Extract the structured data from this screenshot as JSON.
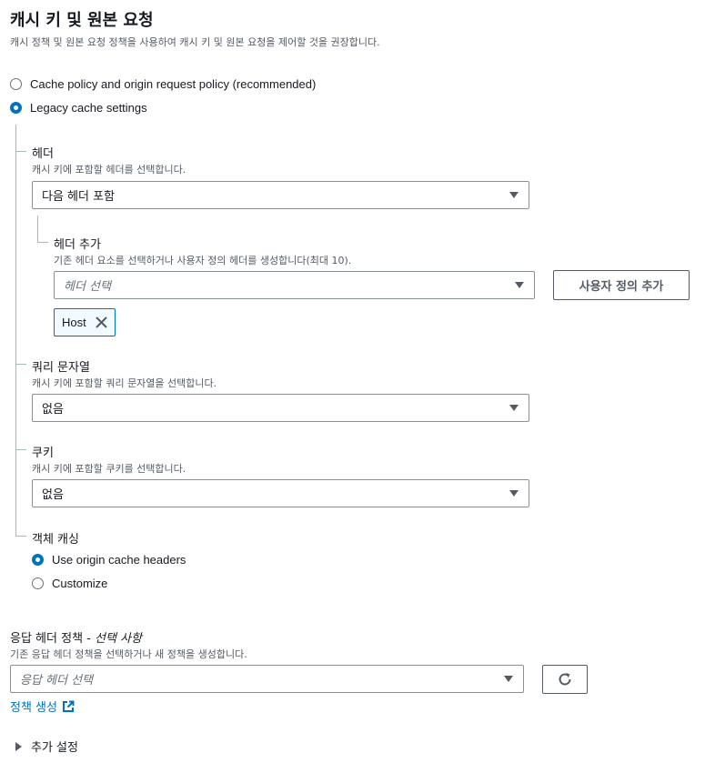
{
  "header": {
    "title": "캐시 키 및 원본 요청",
    "description": "캐시 정책 및 원본 요청 정책을 사용하여 캐시 키 및 원본 요청을 제어할 것을 권장합니다."
  },
  "mode_options": [
    {
      "label": "Cache policy and origin request policy (recommended)",
      "checked": false
    },
    {
      "label": "Legacy cache settings",
      "checked": true
    }
  ],
  "headers": {
    "label": "헤더",
    "description": "캐시 키에 포함할 헤더를 선택합니다.",
    "selected": "다음 헤더 포함",
    "add": {
      "label": "헤더 추가",
      "description": "기존 헤더 요소를 선택하거나 사용자 정의 헤더를 생성합니다(최대 10).",
      "placeholder": "헤더 선택",
      "custom_button": "사용자 정의 추가",
      "tokens": [
        "Host"
      ]
    }
  },
  "query_strings": {
    "label": "쿼리 문자열",
    "description": "캐시 키에 포함할 쿼리 문자열을 선택합니다.",
    "selected": "없음"
  },
  "cookies": {
    "label": "쿠키",
    "description": "캐시 키에 포함할 쿠키를 선택합니다.",
    "selected": "없음"
  },
  "object_caching": {
    "label": "객체 캐싱",
    "options": [
      {
        "label": "Use origin cache headers",
        "checked": true
      },
      {
        "label": "Customize",
        "checked": false
      }
    ]
  },
  "response_headers": {
    "label": "응답 헤더 정책 - ",
    "optional": "선택 사항",
    "description": "기존 응답 헤더 정책을 선택하거나 새 정책을 생성합니다.",
    "placeholder": "응답 헤더 선택",
    "create_link": "정책 생성"
  },
  "additional_settings": {
    "label": "추가 설정"
  },
  "colors": {
    "accent": "#0073bb",
    "text": "#16191f",
    "muted": "#545b64",
    "border": "#879196"
  },
  "icons": [
    "close-icon",
    "refresh-icon",
    "external-link-icon",
    "caret-down-icon",
    "caret-right-icon"
  ]
}
